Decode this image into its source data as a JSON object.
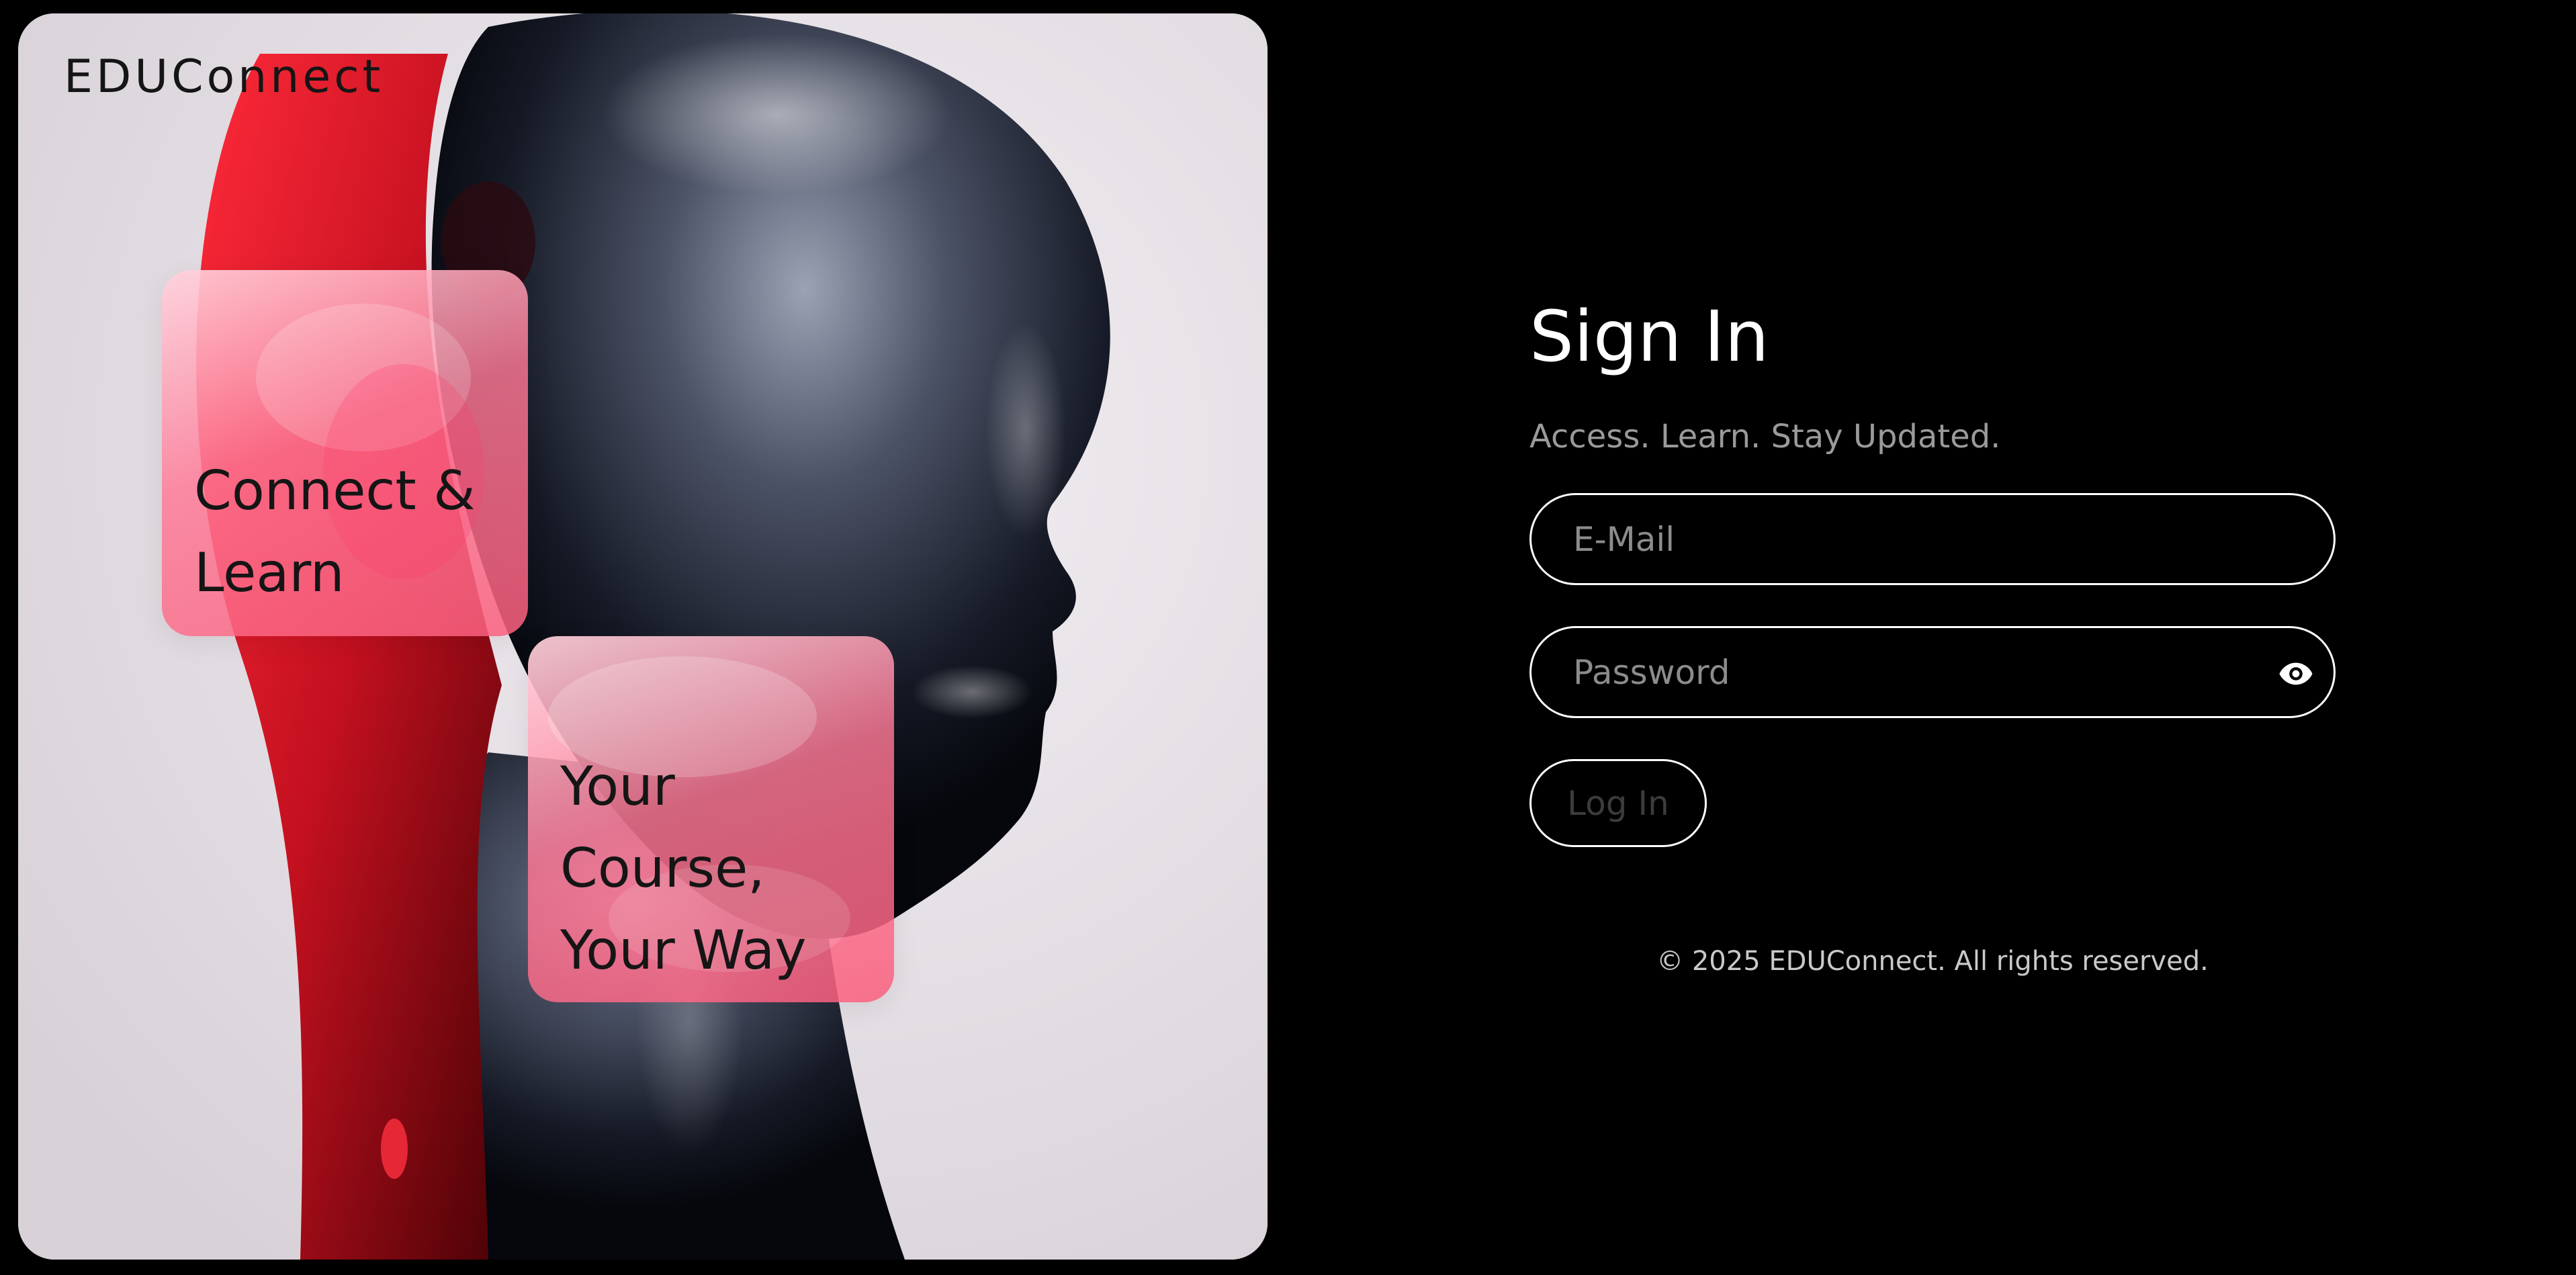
{
  "hero": {
    "brand": "EDUConnect",
    "cards": [
      {
        "line1": "Connect &",
        "line2": "Learn"
      },
      {
        "line1": "Your",
        "line2": "Course,",
        "line3": "Your Way"
      }
    ]
  },
  "signin": {
    "title": "Sign In",
    "subtitle": "Access. Learn. Stay Updated.",
    "email": {
      "placeholder": "E-Mail",
      "value": ""
    },
    "password": {
      "placeholder": "Password",
      "value": ""
    },
    "login_label": "Log In",
    "footer": "© 2025 EDUConnect. All rights reserved."
  },
  "colors": {
    "background": "#000000",
    "card_pink": "#fa5f7d",
    "text_primary": "#ffffff",
    "text_muted": "#9a9a9a"
  },
  "icons": {
    "password_toggle": "eye-icon"
  }
}
